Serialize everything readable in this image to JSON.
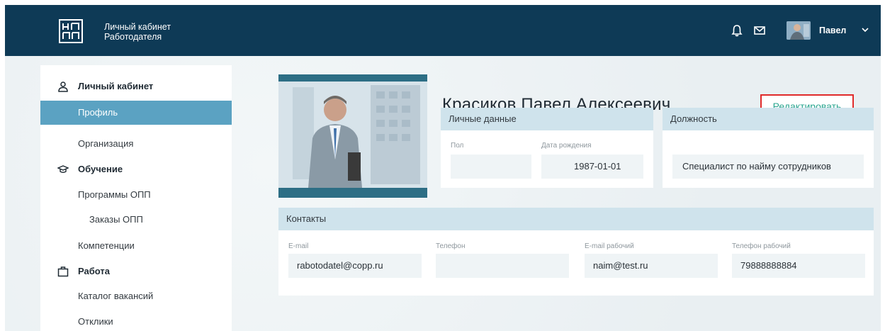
{
  "header": {
    "brand_line1": "Личный кабинет",
    "brand_line2": "Работодателя",
    "user_name": "Павел",
    "bg_color": "#0e3a56"
  },
  "sidebar": {
    "items": [
      {
        "label": "Личный кабинет",
        "type": "section",
        "icon": "user-icon"
      },
      {
        "label": "Профиль",
        "type": "sub",
        "active": true
      },
      {
        "label": "Организация",
        "type": "sub"
      },
      {
        "label": "Обучение",
        "type": "section",
        "icon": "graduation-cap-icon"
      },
      {
        "label": "Программы ОПП",
        "type": "sub"
      },
      {
        "label": "Заказы ОПП",
        "type": "subsub"
      },
      {
        "label": "Компетенции",
        "type": "sub"
      },
      {
        "label": "Работа",
        "type": "section",
        "icon": "briefcase-icon"
      },
      {
        "label": "Каталог вакансий",
        "type": "sub"
      },
      {
        "label": "Отклики",
        "type": "sub"
      }
    ],
    "active_color": "#5ba2c2"
  },
  "profile": {
    "full_name": "Красиков Павел Алексеевич",
    "edit_label": "Редактировать",
    "personal": {
      "title": "Личные данные",
      "gender_label": "Пол",
      "gender_value": "",
      "birth_label": "Дата рождения",
      "birth_value": "1987-01-01"
    },
    "position": {
      "title": "Должность",
      "value": "Специалист по найму сотрудников"
    },
    "contacts": {
      "title": "Контакты",
      "email_label": "E-mail",
      "email_value": "rabotodatel@copp.ru",
      "phone_label": "Телефон",
      "phone_value": "",
      "work_email_label": "E-mail рабочий",
      "work_email_value": "naim@test.ru",
      "work_phone_label": "Телефон рабочий",
      "work_phone_value": "79888888884"
    }
  },
  "colors": {
    "card_header": "#cfe3ec",
    "edit_text": "#2aa58f",
    "highlight_border": "#e02b2b"
  }
}
